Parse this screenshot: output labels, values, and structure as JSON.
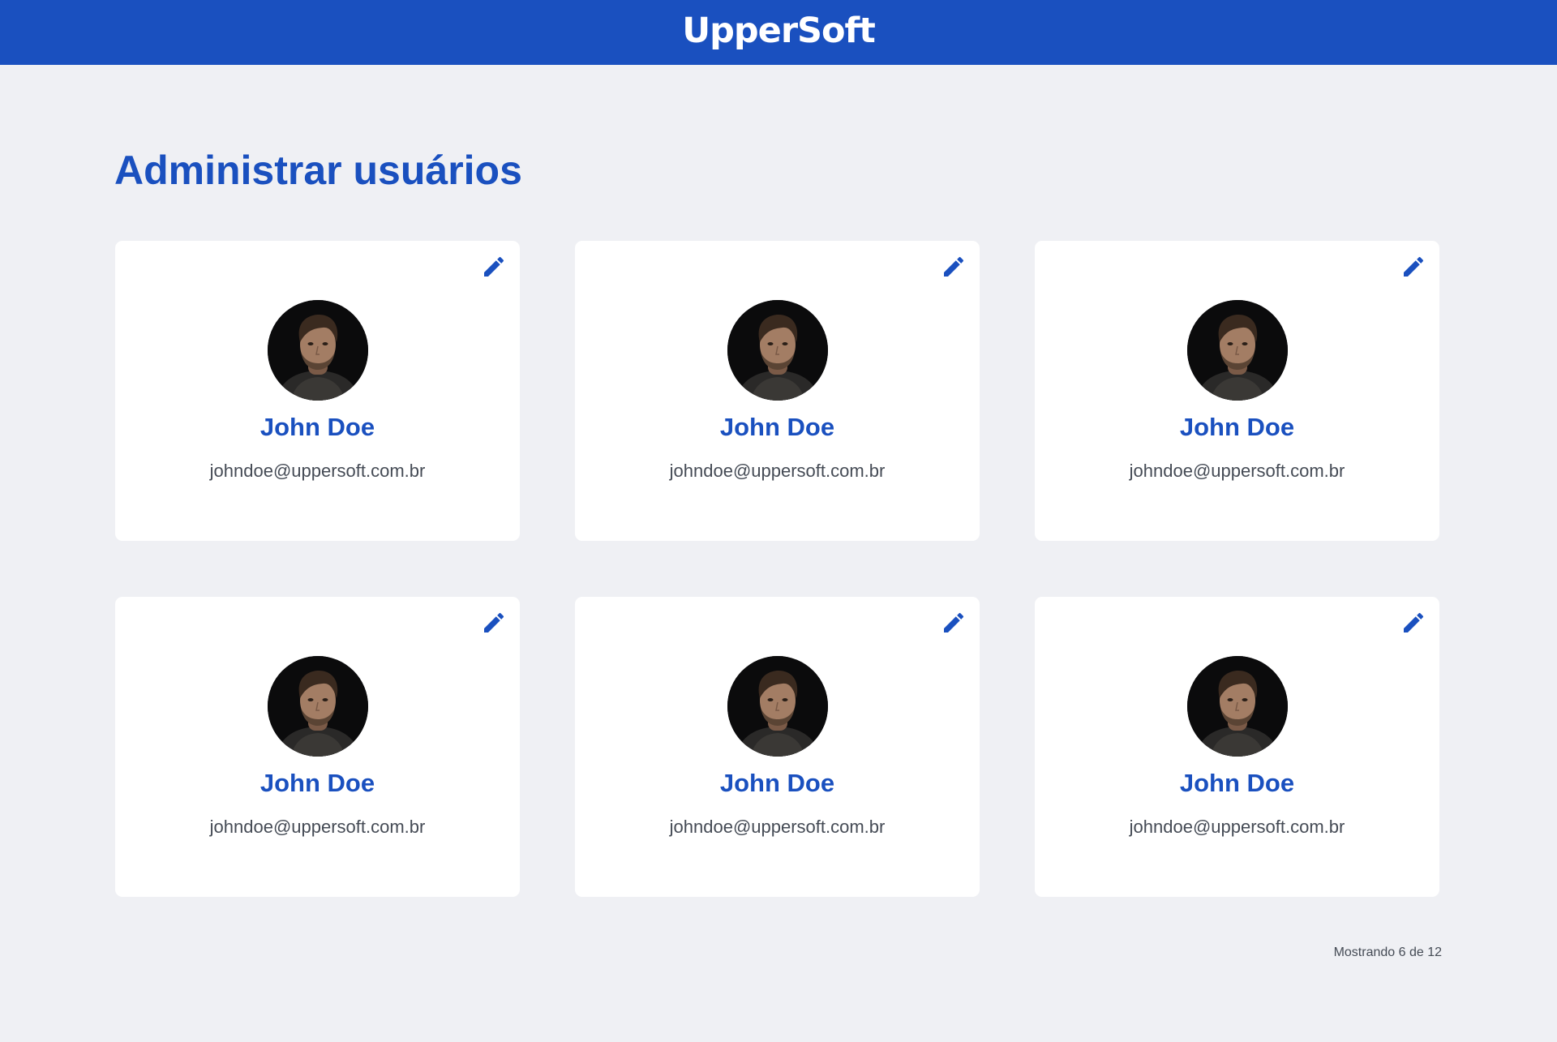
{
  "header": {
    "logo_text": "UpperSoft",
    "background_color": "#1a50bf"
  },
  "page": {
    "title": "Administrar usuários",
    "background_color": "#eff0f4"
  },
  "users": [
    {
      "name": "John Doe",
      "email": "johndoe@uppersoft.com.br",
      "avatar_icon": "user-photo",
      "edit_icon": "pencil-icon"
    },
    {
      "name": "John Doe",
      "email": "johndoe@uppersoft.com.br",
      "avatar_icon": "user-photo",
      "edit_icon": "pencil-icon"
    },
    {
      "name": "John Doe",
      "email": "johndoe@uppersoft.com.br",
      "avatar_icon": "user-photo",
      "edit_icon": "pencil-icon"
    },
    {
      "name": "John Doe",
      "email": "johndoe@uppersoft.com.br",
      "avatar_icon": "user-photo",
      "edit_icon": "pencil-icon"
    },
    {
      "name": "John Doe",
      "email": "johndoe@uppersoft.com.br",
      "avatar_icon": "user-photo",
      "edit_icon": "pencil-icon"
    },
    {
      "name": "John Doe",
      "email": "johndoe@uppersoft.com.br",
      "avatar_icon": "user-photo",
      "edit_icon": "pencil-icon"
    }
  ],
  "pagination": {
    "status_text": "Mostrando 6 de 12"
  },
  "colors": {
    "accent": "#1a50bf",
    "text_secondary": "#454b55",
    "card_background": "#ffffff"
  }
}
